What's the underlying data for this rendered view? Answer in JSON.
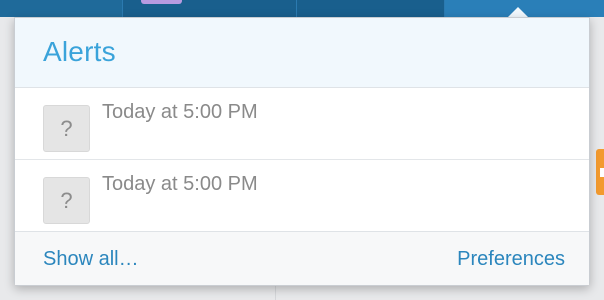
{
  "alerts_panel": {
    "title": "Alerts",
    "items": [
      {
        "icon": "question-mark-icon",
        "icon_glyph": "?",
        "time": "Today at 5:00 PM"
      },
      {
        "icon": "question-mark-icon",
        "icon_glyph": "?",
        "time": "Today at 5:00 PM"
      }
    ],
    "footer": {
      "show_all_label": "Show all…",
      "preferences_label": "Preferences"
    }
  },
  "colors": {
    "accent": "#3aa3da",
    "link": "#2b86bd",
    "topbar": "#1f6a9a",
    "muted_text": "#8a8a8a"
  }
}
